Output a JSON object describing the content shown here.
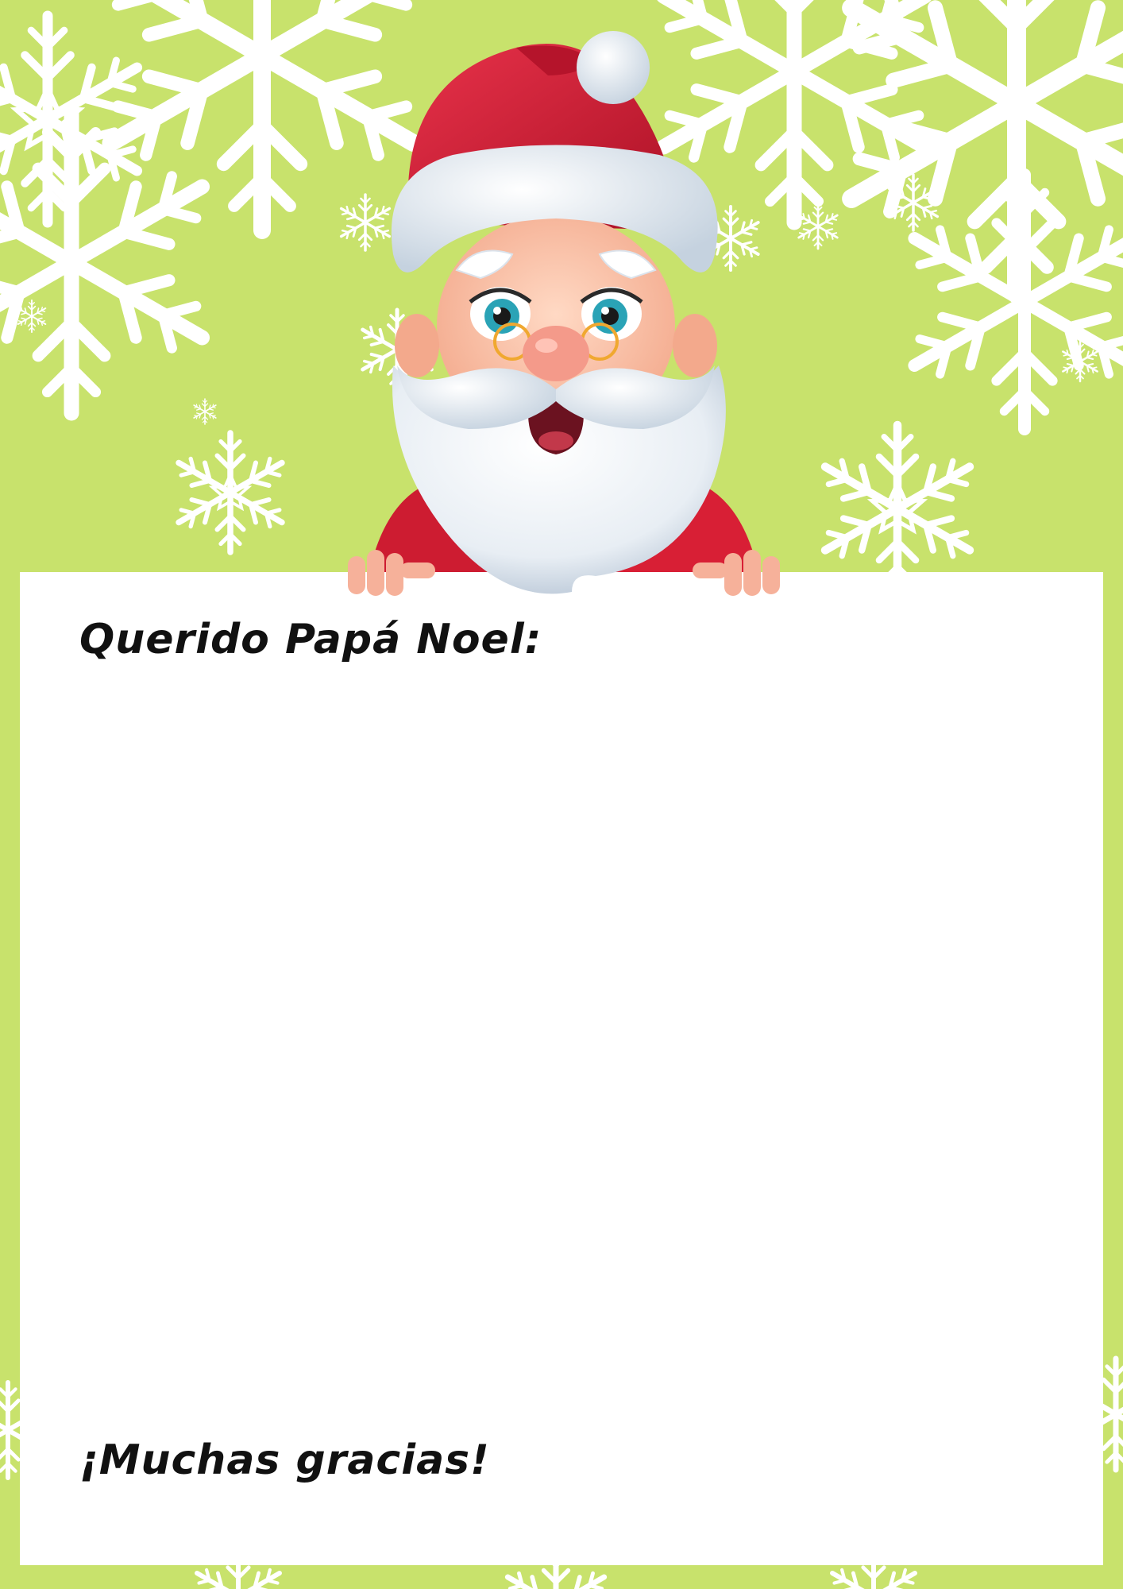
{
  "letter": {
    "greeting": "Querido Papá Noel:",
    "closing": "¡Muchas gracias!"
  },
  "colors": {
    "background": "#c8e26c",
    "paper": "#ffffff",
    "snowflake": "#ffffff",
    "santa_red": "#d81f35",
    "text": "#111111"
  },
  "illustration": {
    "character": "santa-claus",
    "decoration": "snowflake-icon"
  }
}
